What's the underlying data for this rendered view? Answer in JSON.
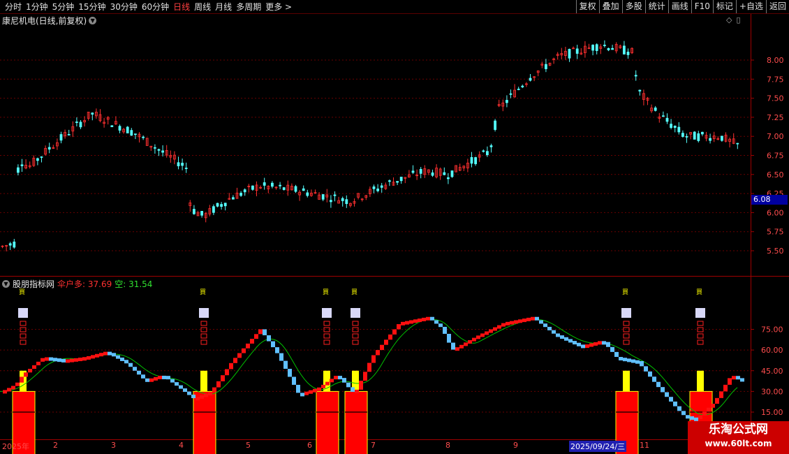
{
  "toolbar": {
    "periods": [
      "分时",
      "1分钟",
      "5分钟",
      "15分钟",
      "30分钟",
      "60分钟",
      "日线",
      "周线",
      "月线",
      "多周期",
      "更多 >"
    ],
    "active_period": "日线",
    "right_buttons": [
      "复权",
      "叠加",
      "多股",
      "统计",
      "画线",
      "F10",
      "标记",
      "+自选",
      "返回"
    ]
  },
  "main_chart": {
    "title": "康尼机电(日线,前复权)",
    "price_axis": [
      "8.00",
      "7.75",
      "7.50",
      "7.25",
      "7.00",
      "6.75",
      "6.50",
      "6.25",
      "6.00",
      "5.75",
      "5.50"
    ],
    "current_price": "6.08",
    "up_color": "#ff3030",
    "down_color": "#54ffff"
  },
  "indicator": {
    "name": "股朋指标网",
    "label_long": "伞户多: 37.69",
    "label_short": "空: 31.54",
    "axis": [
      "75.00",
      "60.00",
      "45.00",
      "30.00",
      "15.00"
    ],
    "signal_char": "買",
    "marker_text": "口口口口",
    "signal_count": 7,
    "colors": {
      "line_up": "#ff1010",
      "line_down": "#60c0ff",
      "ma": "#00c000",
      "yellow": "#ffff00",
      "box": "#ff0000",
      "marker": "#d8d8f8"
    }
  },
  "dates": {
    "labels": [
      "2025年",
      "2",
      "3",
      "4",
      "5",
      "6",
      "7",
      "8",
      "9",
      "2025/09/24/三",
      "11"
    ],
    "current": "2025/09/24/三"
  },
  "watermark": {
    "line1": "乐淘公式网",
    "line2": "www.60lt.com"
  }
}
